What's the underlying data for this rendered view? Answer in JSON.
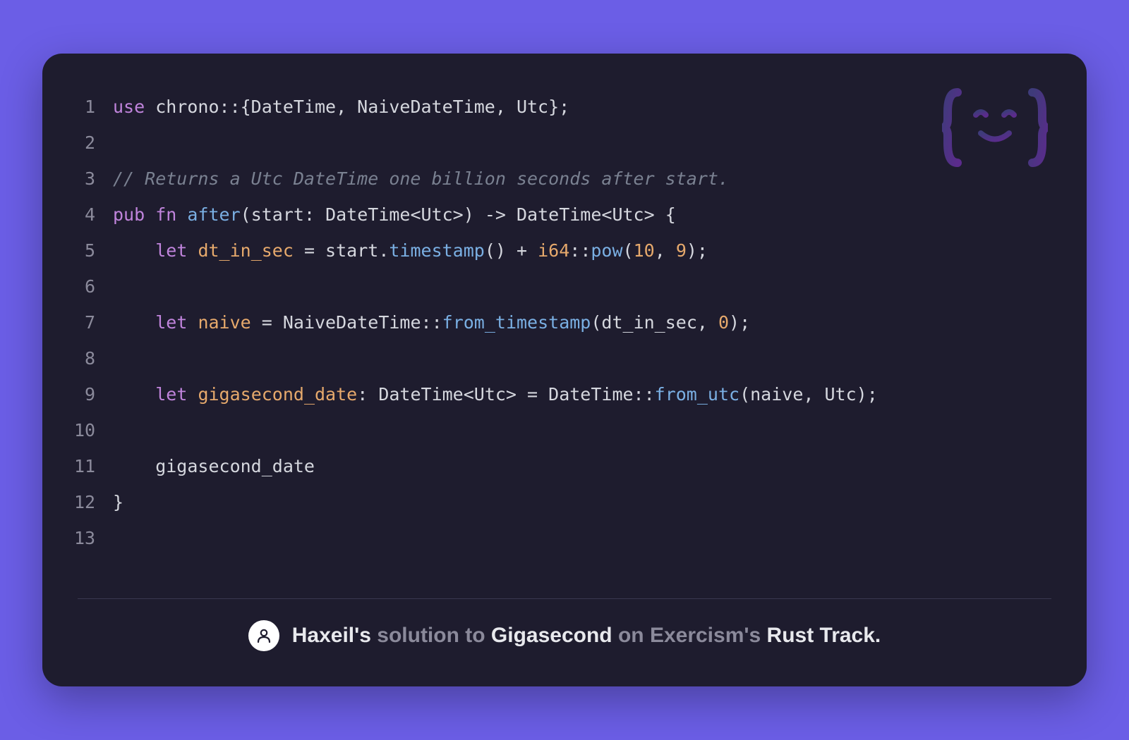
{
  "code": {
    "lines": [
      {
        "n": 1
      },
      {
        "n": 2
      },
      {
        "n": 3
      },
      {
        "n": 4
      },
      {
        "n": 5
      },
      {
        "n": 6
      },
      {
        "n": 7
      },
      {
        "n": 8
      },
      {
        "n": 9
      },
      {
        "n": 10
      },
      {
        "n": 11
      },
      {
        "n": 12
      },
      {
        "n": 13
      }
    ],
    "tokens": {
      "use": "use",
      "chrono_path": " chrono::{DateTime, NaiveDateTime, Utc};",
      "comment": "// Returns a Utc DateTime one billion seconds after start.",
      "pub": "pub",
      "fn": "fn",
      "after": "after",
      "sig_open": "(start: DateTime<Utc>) -> DateTime<Utc> {",
      "let1": "let",
      "dt_in_sec_decl": "dt_in_sec",
      "eq_start": " = start.",
      "timestamp": "timestamp",
      "plus": "() + ",
      "i64": "i64",
      "dcolon": "::",
      "pow": "pow",
      "pow_open": "(",
      "ten": "10",
      "comma": ", ",
      "nine": "9",
      "pow_close": ");",
      "let2": "let",
      "naive_decl": "naive",
      "eq_naive": " = NaiveDateTime::",
      "from_timestamp": "from_timestamp",
      "ft_open": "(dt_in_sec, ",
      "zero": "0",
      "ft_close": ");",
      "let3": "let",
      "giga_decl": "gigasecond_date",
      "giga_type": ": DateTime<Utc> = DateTime::",
      "from_utc": "from_utc",
      "fu_args": "(naive, Utc);",
      "return_line": "    gigasecond_date",
      "close_brace": "}"
    }
  },
  "footer": {
    "author": "Haxeil's",
    "solution_to": " solution to ",
    "exercise": "Gigasecond",
    "on": " on Exercism's ",
    "track": "Rust Track."
  }
}
